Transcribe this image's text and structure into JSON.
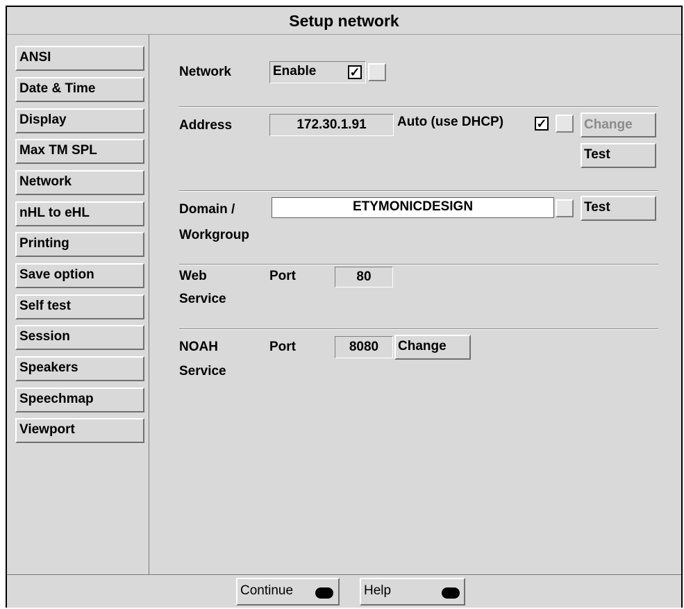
{
  "window": {
    "title": "Setup network"
  },
  "sidebar": {
    "items": [
      {
        "label": "ANSI"
      },
      {
        "label": "Date & Time"
      },
      {
        "label": "Display"
      },
      {
        "label": "Max TM SPL"
      },
      {
        "label": "Network"
      },
      {
        "label": "nHL to eHL"
      },
      {
        "label": "Printing"
      },
      {
        "label": "Save option"
      },
      {
        "label": "Self test"
      },
      {
        "label": "Session"
      },
      {
        "label": "Speakers"
      },
      {
        "label": "Speechmap"
      },
      {
        "label": "Viewport"
      }
    ]
  },
  "network": {
    "label": "Network",
    "enable_label": "Enable",
    "enable_checked": true
  },
  "address": {
    "label": "Address",
    "value": "172.30.1.91",
    "auto_label": "Auto (use DHCP)",
    "auto_checked": true,
    "change_label": "Change",
    "test_label": "Test"
  },
  "domain": {
    "label_line1": "Domain /",
    "label_line2": "Workgroup",
    "value": "ETYMONICDESIGN",
    "test_label": "Test"
  },
  "web_service": {
    "label_line1": "Web",
    "label_line2": "Service",
    "port_label": "Port",
    "port_value": "80"
  },
  "noah_service": {
    "label_line1": "NOAH",
    "label_line2": "Service",
    "port_label": "Port",
    "port_value": "8080",
    "change_label": "Change"
  },
  "bottom": {
    "continue_label": "Continue",
    "help_label": "Help"
  },
  "checkmark_glyph": "✓"
}
